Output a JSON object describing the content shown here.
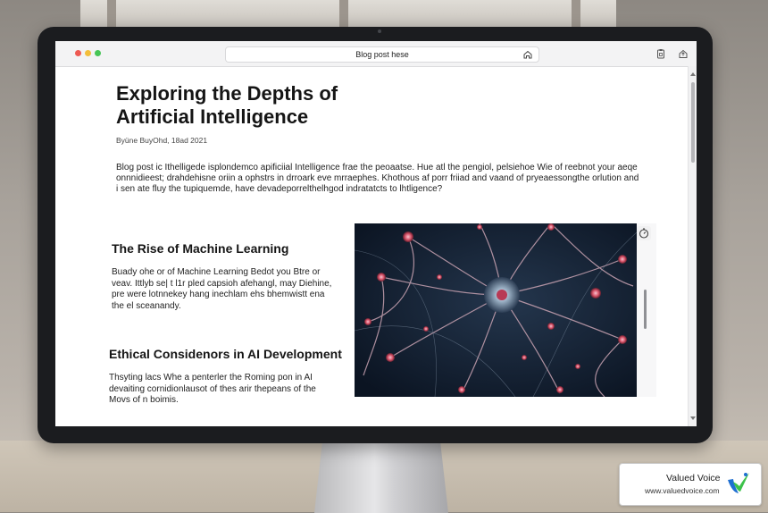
{
  "browser": {
    "address_bar_text": "Blog post hese"
  },
  "article": {
    "title": "Exploring the Depths of Artificial Intelligence",
    "byline": "Byüne BuyOhd, 18ad 2021",
    "intro": "Blog post ic Ithelligede isplondemco apificiial Intelligence frae the peoaatse. Hue atl the pengiol, pelsiehoe Wie of reebnot your aeqe onnnidieest; drahdehisne oriin a ophstrs in drroark eve mrraephes. Khothous af porr friiad and vaand of pryeaessongthe orlution and i sen ate fluy the tupiquemde, have devadeporrelthelhgod indratatcts to lhtligence?",
    "sections": [
      {
        "heading": "The Rise of Machine Learning",
        "body": "Buady ohe or of Machine Learning Bedot you Btre or veav. Ittlyb se| t l1r pled capsioh afehangl, may Diehine, pre were lotnnekey hang inechlam ehs bhemwistt ena the el sceanandy."
      },
      {
        "heading": "Ethical Considenors in AI Development",
        "body": "Thsyting lacs Whe a penterler the Roming pon in AI devaiting cornidionlausot of thes arir thepeans of the Movs of n boimis."
      }
    ]
  },
  "watermark": {
    "name": "Valued Voice",
    "url": "www.valuedvoice.com"
  },
  "colors": {
    "accent_red": "#ee5a52",
    "accent_yellow": "#f3be3b",
    "accent_green": "#47c556",
    "neuron_glow": "#d9546a",
    "image_bg": "#0f1a2b",
    "logo_blue": "#1f6fd1",
    "logo_green": "#3cc24a"
  },
  "icons": {
    "address_home": "home-icon",
    "toolbar_1": "clipboard-icon",
    "toolbar_2": "share-icon",
    "figure_tool": "timer-icon"
  }
}
